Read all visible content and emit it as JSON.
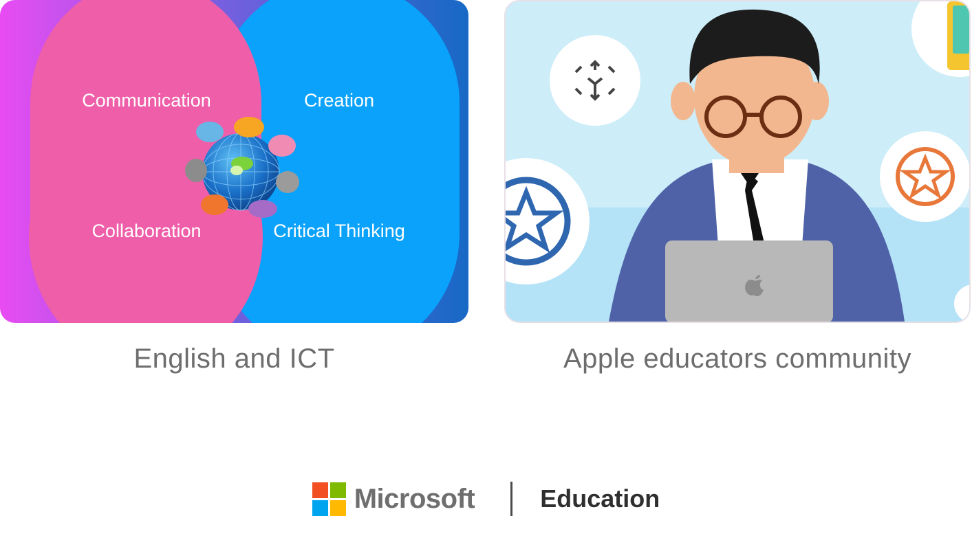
{
  "cards": [
    {
      "caption": "English and ICT",
      "venn_labels": {
        "top_left": "Communication",
        "top_right": "Creation",
        "bottom_left": "Collaboration",
        "bottom_right": "Critical Thinking"
      },
      "colors": {
        "background": "#1b6fc9",
        "pink": "#ee5fa7",
        "blue": "#0aa2fb",
        "violet": "#e64bf0"
      },
      "icon": "globe-with-social-icons"
    },
    {
      "caption": "Apple educators community",
      "icon": "teacher-with-laptop-illustration",
      "colors": {
        "background": "#cfeef9",
        "suit": "#4f62a8"
      }
    }
  ],
  "footer": {
    "brand": "Microsoft",
    "product": "Education",
    "logo_colors": [
      "#f25022",
      "#7fba00",
      "#00a4ef",
      "#ffb900"
    ]
  }
}
